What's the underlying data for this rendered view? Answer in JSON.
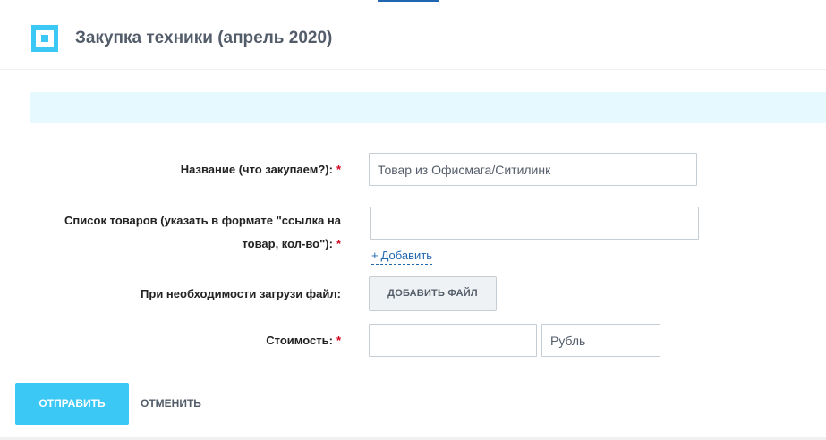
{
  "header": {
    "title": "Закупка техники (апрель 2020)"
  },
  "form": {
    "name_field": {
      "label": "Название (что закупаем?):",
      "required_mark": "*",
      "value": "Товар из Офисмага/Ситилинк"
    },
    "items_field": {
      "label_line1": "Список товаров (указать в формате \"ссылка на",
      "label_line2": "товар, кол-во\"):",
      "required_mark": "*",
      "value": "",
      "add_plus": "+",
      "add_label": "Добавить"
    },
    "file_field": {
      "label": "При необходимости загрузи файл:",
      "button_label": "ДОБАВИТЬ ФАЙЛ"
    },
    "cost_field": {
      "label": "Стоимость:",
      "required_mark": "*",
      "amount_value": "",
      "currency_value": "Рубль"
    }
  },
  "actions": {
    "submit_label": "ОТПРАВИТЬ",
    "cancel_label": "ОТМЕНИТЬ"
  },
  "colors": {
    "accent": "#3bc8f5",
    "link": "#2067b0",
    "required": "#d0021b",
    "banner": "#e5f9ff"
  }
}
